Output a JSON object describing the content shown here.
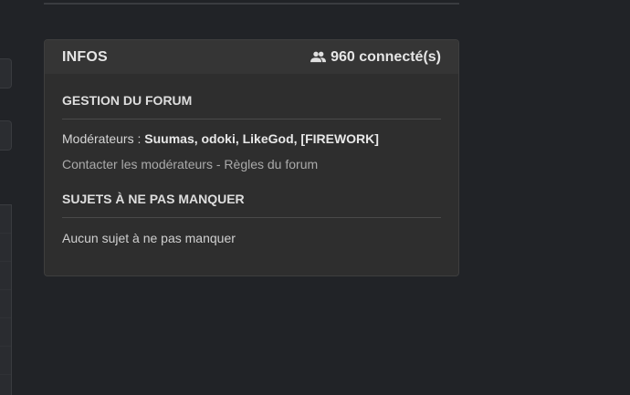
{
  "infos": {
    "title": "INFOS",
    "online_count": "960 connecté(s)",
    "online_icon": "users-icon"
  },
  "gestion": {
    "title": "GESTION DU FORUM",
    "moderators_label": "Modérateurs :",
    "moderators": "Suumas, odoki, LikeGod, [FIREWORK]",
    "contact_link": "Contacter les modérateurs",
    "separator": "-",
    "rules_link": "Règles du forum"
  },
  "sujets": {
    "title": "SUJETS À NE PAS MANQUER",
    "empty_text": "Aucun sujet à ne pas manquer"
  }
}
